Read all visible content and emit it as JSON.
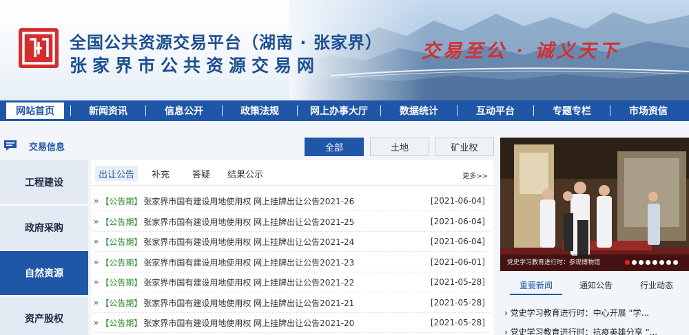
{
  "header": {
    "title_line1": "全国公共资源交易平台（湖南 · 张家界）",
    "title_line2": "张家界市公共资源交易网",
    "slogan": "交易至公 · 诚义天下"
  },
  "nav": {
    "items": [
      {
        "label": "网站首页",
        "active": true
      },
      {
        "label": "新闻资讯"
      },
      {
        "label": "信息公开"
      },
      {
        "label": "政策法规"
      },
      {
        "label": "网上办事大厅"
      },
      {
        "label": "数据统计"
      },
      {
        "label": "互动平台"
      },
      {
        "label": "专题专栏"
      },
      {
        "label": "市场资信"
      }
    ]
  },
  "trade_info": {
    "title": "交易信息",
    "categories": [
      {
        "label": "工程建设"
      },
      {
        "label": "政府采购"
      },
      {
        "label": "自然资源",
        "active": true
      },
      {
        "label": "资产股权"
      }
    ],
    "filters": [
      {
        "label": "全部",
        "active": true
      },
      {
        "label": "土地"
      },
      {
        "label": "矿业权"
      }
    ]
  },
  "notices": {
    "tabs": [
      "出让公告",
      "补充",
      "答疑",
      "结果公示"
    ],
    "more": "更多>>",
    "rows": [
      {
        "tag": "【公告期】",
        "title": "张家界市国有建设用地使用权 网上挂牌出让公告2021-26",
        "date": "[2021-06-04]"
      },
      {
        "tag": "【公告期】",
        "title": "张家界市国有建设用地使用权 网上挂牌出让公告2021-25",
        "date": "[2021-06-04]"
      },
      {
        "tag": "【公告期】",
        "title": "张家界市国有建设用地使用权 网上挂牌出让公告2021-24",
        "date": "[2021-06-04]"
      },
      {
        "tag": "【公告期】",
        "title": "张家界市国有建设用地使用权 网上挂牌出让公告2021-23",
        "date": "[2021-06-01]"
      },
      {
        "tag": "【公告期】",
        "title": "张家界市国有建设用地使用权 网上挂牌出让公告2021-22",
        "date": "[2021-05-28]"
      },
      {
        "tag": "【公告期】",
        "title": "张家界市国有建设用地使用权 网上挂牌出让公告2021-21",
        "date": "[2021-05-28]"
      },
      {
        "tag": "【公告期】",
        "title": "张家界市国有建设用地使用权 网上挂牌出让公告2021-20",
        "date": "[2021-05-28]"
      }
    ]
  },
  "slideshow": {
    "caption": "党史学习教育进行时：参观博物馆",
    "active_slide": 1,
    "slide_count": 8
  },
  "news": {
    "tabs": [
      "重要新闻",
      "通知公告",
      "行业动态"
    ],
    "items": [
      "党史学习教育进行时：中心开展 “学...",
      "党史学习教育进行时：抗疫英雄分享 “..."
    ]
  },
  "colors": {
    "nav_bg": "#2056a8",
    "title_blue": "#1d4f91",
    "slogan_red": "#d43030",
    "tag_green": "#2e8b2e",
    "logo_red": "#d42d2d"
  },
  "icons": {
    "logo": "logo-emblem",
    "trade_info": "chat-bubble-icon"
  }
}
